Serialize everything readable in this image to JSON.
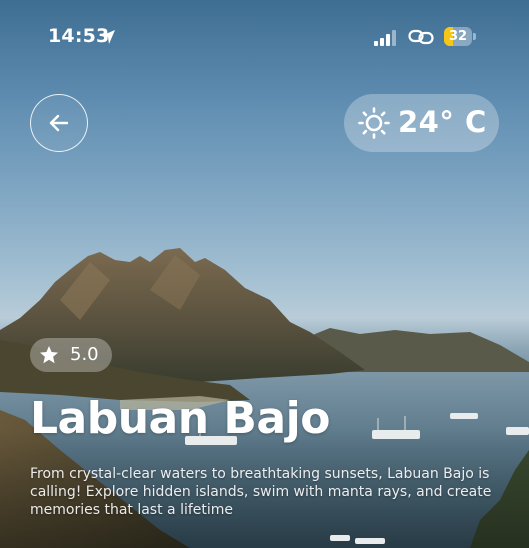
{
  "status_bar": {
    "time": "14:53",
    "location_icon": "location-arrow-icon",
    "signal_icon": "cellular-signal-icon",
    "link_icon": "personal-hotspot-icon",
    "battery_level": "32",
    "battery_fill_fraction": 0.32,
    "battery_color": "#f5c518"
  },
  "header": {
    "back_icon": "arrow-left-icon",
    "weather": {
      "icon": "sun-icon",
      "temperature": "24° C"
    }
  },
  "destination": {
    "rating_icon": "star-icon",
    "rating": "5.0",
    "name": "Labuan Bajo",
    "description": "From crystal-clear waters to breathtaking sunsets, Labuan Bajo is calling! Explore hidden islands, swim with manta rays, and create memories that last a lifetime"
  }
}
